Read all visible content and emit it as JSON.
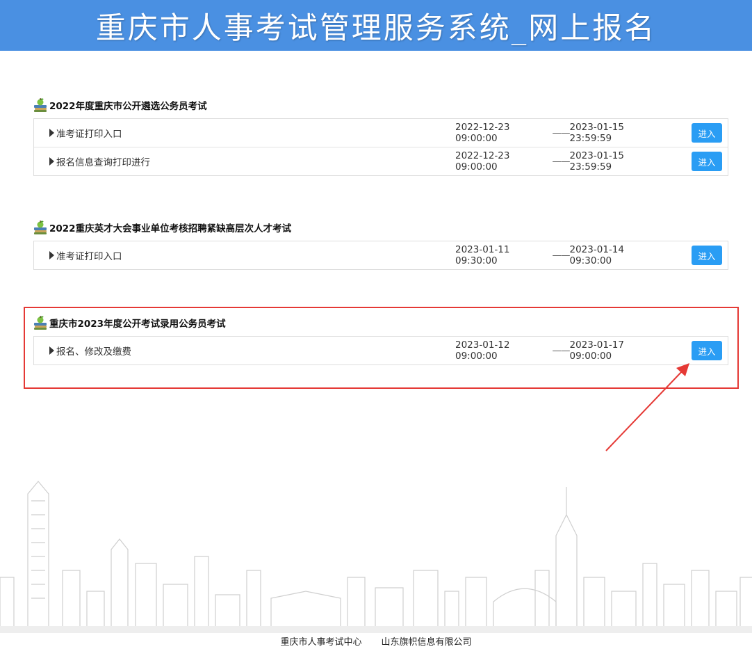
{
  "banner": {
    "title": "重庆市人事考试管理服务系统_网上报名"
  },
  "sections": [
    {
      "title": "2022年度重庆市公开遴选公务员考试",
      "rows": [
        {
          "label": "准考证打印入口",
          "start": "2022-12-23 09:00:00",
          "sep": "——",
          "end": "2023-01-15 23:59:59",
          "button": "进入"
        },
        {
          "label": "报名信息查询打印进行",
          "start": "2022-12-23 09:00:00",
          "sep": "——",
          "end": "2023-01-15 23:59:59",
          "button": "进入"
        }
      ]
    },
    {
      "title": "2022重庆英才大会事业单位考核招聘紧缺高层次人才考试",
      "rows": [
        {
          "label": "准考证打印入口",
          "start": "2023-01-11 09:30:00",
          "sep": "——",
          "end": "2023-01-14 09:30:00",
          "button": "进入"
        }
      ]
    },
    {
      "title": "重庆市2023年度公开考试录用公务员考试",
      "rows": [
        {
          "label": "报名、修改及缴费",
          "start": "2023-01-12 09:00:00",
          "sep": "——",
          "end": "2023-01-17 09:00:00",
          "button": "进入"
        }
      ]
    }
  ],
  "footer": {
    "org": "重庆市人事考试中心",
    "vendor": "山东旗帜信息有限公司"
  },
  "colors": {
    "banner": "#4a90e2",
    "button": "#2a9df4",
    "highlight": "#e53935"
  }
}
